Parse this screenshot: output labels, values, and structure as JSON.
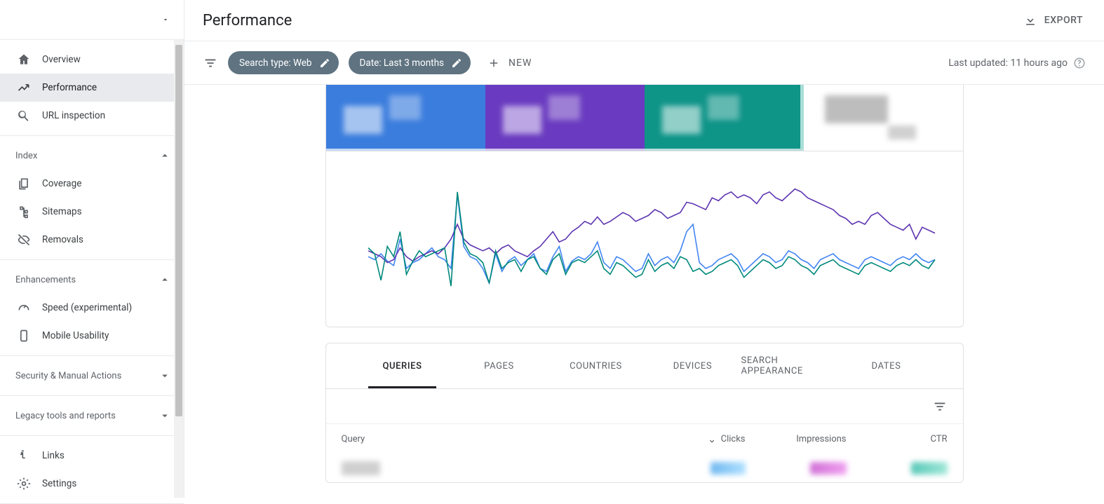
{
  "header": {
    "title": "Performance",
    "export_label": "EXPORT"
  },
  "filters": {
    "search_type_chip": "Search type: Web",
    "date_chip": "Date: Last 3 months",
    "add_new_label": "NEW",
    "last_updated": "Last updated: 11 hours ago"
  },
  "sidebar": {
    "items_top": [
      {
        "label": "Overview",
        "icon": "home"
      },
      {
        "label": "Performance",
        "icon": "trend",
        "active": true
      },
      {
        "label": "URL inspection",
        "icon": "search"
      }
    ],
    "section_index": {
      "title": "Index"
    },
    "items_index": [
      {
        "label": "Coverage",
        "icon": "copy"
      },
      {
        "label": "Sitemaps",
        "icon": "tree"
      },
      {
        "label": "Removals",
        "icon": "eye-off"
      }
    ],
    "section_enh": {
      "title": "Enhancements"
    },
    "items_enh": [
      {
        "label": "Speed (experimental)",
        "icon": "gauge"
      },
      {
        "label": "Mobile Usability",
        "icon": "phone"
      }
    ],
    "section_sec": {
      "title": "Security & Manual Actions"
    },
    "section_legacy": {
      "title": "Legacy tools and reports"
    },
    "items_bottom": [
      {
        "label": "Links",
        "icon": "links"
      },
      {
        "label": "Settings",
        "icon": "gear"
      }
    ]
  },
  "tabs": {
    "items": [
      {
        "label": "QUERIES",
        "active": true
      },
      {
        "label": "PAGES"
      },
      {
        "label": "COUNTRIES"
      },
      {
        "label": "DEVICES"
      },
      {
        "label": "SEARCH APPEARANCE"
      },
      {
        "label": "DATES"
      }
    ]
  },
  "table": {
    "columns": {
      "query": "Query",
      "clicks": "Clicks",
      "impressions": "Impressions",
      "ctr": "CTR"
    }
  },
  "chart_data": {
    "type": "line",
    "x_count": 90,
    "series": [
      {
        "name": "Clicks",
        "color": "#4285f4",
        "values": [
          38,
          36,
          40,
          35,
          32,
          50,
          30,
          34,
          36,
          40,
          44,
          38,
          36,
          30,
          80,
          45,
          38,
          36,
          30,
          20,
          40,
          28,
          35,
          38,
          32,
          36,
          40,
          30,
          28,
          38,
          45,
          28,
          35,
          38,
          36,
          40,
          48,
          34,
          30,
          38,
          36,
          32,
          28,
          30,
          40,
          32,
          36,
          38,
          34,
          42,
          55,
          60,
          34,
          30,
          32,
          36,
          38,
          40,
          36,
          28,
          32,
          36,
          40,
          38,
          34,
          36,
          42,
          40,
          36,
          34,
          30,
          36,
          38,
          40,
          36,
          34,
          32,
          30,
          36,
          38,
          36,
          34,
          32,
          36,
          38,
          36,
          40,
          36,
          34,
          36
        ]
      },
      {
        "name": "Impressions",
        "color": "#5e35b1",
        "values": [
          42,
          40,
          38,
          34,
          36,
          44,
          38,
          35,
          38,
          40,
          42,
          40,
          44,
          50,
          60,
          50,
          46,
          44,
          42,
          44,
          40,
          44,
          46,
          42,
          40,
          38,
          42,
          45,
          50,
          55,
          48,
          50,
          55,
          58,
          62,
          60,
          65,
          60,
          62,
          65,
          68,
          66,
          62,
          64,
          66,
          70,
          68,
          64,
          66,
          68,
          75,
          74,
          72,
          70,
          78,
          76,
          80,
          82,
          78,
          80,
          78,
          74,
          80,
          82,
          78,
          76,
          80,
          84,
          82,
          78,
          76,
          74,
          72,
          70,
          66,
          64,
          60,
          62,
          60,
          66,
          68,
          64,
          60,
          58,
          56,
          60,
          50,
          58,
          56,
          54
        ]
      },
      {
        "name": "CTR",
        "color": "#00897b",
        "values": [
          44,
          40,
          22,
          45,
          38,
          55,
          26,
          35,
          42,
          38,
          40,
          42,
          44,
          18,
          82,
          48,
          40,
          38,
          34,
          20,
          42,
          30,
          34,
          36,
          28,
          36,
          38,
          30,
          26,
          36,
          40,
          26,
          34,
          36,
          34,
          38,
          42,
          30,
          26,
          34,
          32,
          28,
          24,
          26,
          36,
          28,
          32,
          34,
          30,
          38,
          36,
          28,
          30,
          26,
          28,
          32,
          34,
          36,
          32,
          24,
          28,
          32,
          36,
          34,
          30,
          32,
          38,
          36,
          32,
          30,
          26,
          32,
          34,
          36,
          32,
          30,
          28,
          26,
          32,
          34,
          32,
          30,
          28,
          32,
          34,
          32,
          36,
          32,
          30,
          36
        ]
      }
    ]
  }
}
